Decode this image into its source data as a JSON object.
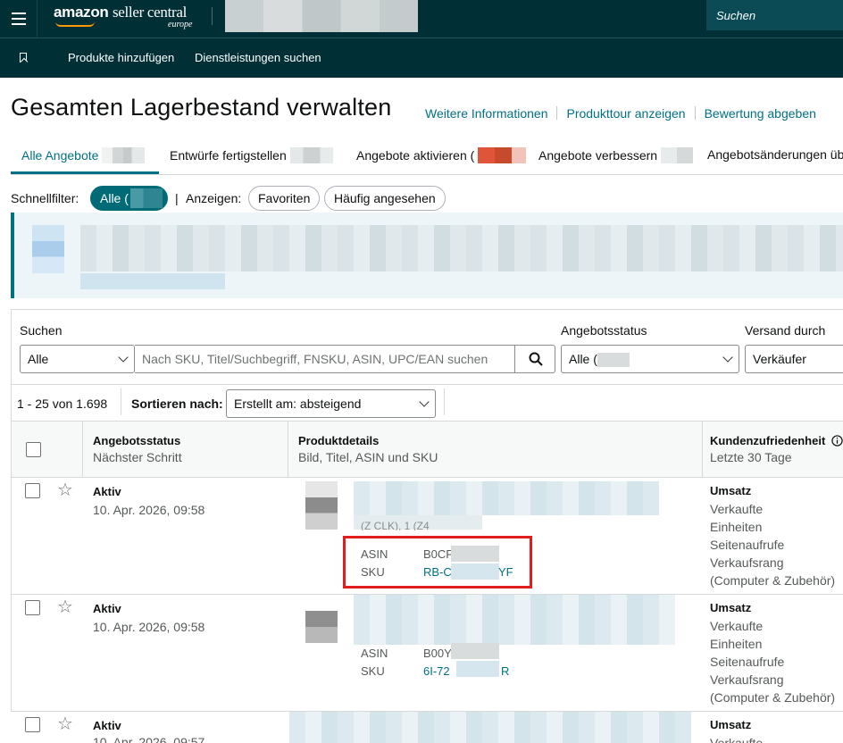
{
  "topbar": {
    "logo_main": "amazon",
    "logo_seller": "seller central",
    "logo_region": "europe",
    "search_placeholder": "Suchen"
  },
  "subnav": {
    "items": [
      "Produkte hinzufügen",
      "Dienstleistungen suchen"
    ]
  },
  "page": {
    "title": "Gesamten Lagerbestand verwalten",
    "links": [
      "Weitere Informationen",
      "Produkttour anzeigen",
      "Bewertung abgeben"
    ]
  },
  "tabs": [
    {
      "label": "Alle Angebote"
    },
    {
      "label": "Entwürfe fertigstellen"
    },
    {
      "label": "Angebote aktivieren ("
    },
    {
      "label": "Angebote verbessern"
    },
    {
      "label": "Angebotsänderungen üb"
    }
  ],
  "quickfilter": {
    "label": "Schnellfilter:",
    "all": "Alle (",
    "divider": "|",
    "show_label": "Anzeigen:",
    "favorites": "Favoriten",
    "frequent": "Häufig angesehen"
  },
  "filters": {
    "search_label": "Suchen",
    "search_scope": "Alle",
    "search_placeholder": "Nach SKU, Titel/Suchbegriff, FNSKU, ASIN, UPC/EAN suchen",
    "status_label": "Angebotsstatus",
    "status_value": "Alle (",
    "fulfillment_label": "Versand durch",
    "fulfillment_value": "Verkäufer"
  },
  "pager": {
    "range": "1 - 25 von 1.698",
    "sort_label": "Sortieren nach:",
    "sort_value": "Erstellt am: absteigend"
  },
  "table": {
    "headers": [
      {
        "title": "Angebotsstatus",
        "sub": "Nächster Schritt"
      },
      {
        "title": "Produktdetails",
        "sub": "Bild, Titel, ASIN und SKU"
      },
      {
        "title": "Kundenzufriedenheit",
        "sub": "Letzte 30 Tage"
      }
    ],
    "rows": [
      {
        "status": "Aktiv",
        "date": "10. Apr. 2026, 09:58",
        "title_fragment": "(Z CLK), 1 (Z4",
        "asin_label": "ASIN",
        "asin": "B0CF",
        "sku_label": "SKU",
        "sku_start": "RB-C",
        "sku_end": "YF",
        "metrics": [
          "Umsatz",
          "Verkaufte",
          "Einheiten",
          "Seitenaufrufe",
          "Verkaufsrang",
          "(Computer & Zubehör)"
        ]
      },
      {
        "status": "Aktiv",
        "date": "10. Apr. 2026, 09:58",
        "asin_label": "ASIN",
        "asin": "B00Y",
        "sku_label": "SKU",
        "sku_start": "6I-72",
        "sku_end": "R",
        "metrics": [
          "Umsatz",
          "Verkaufte",
          "Einheiten",
          "Seitenaufrufe",
          "Verkaufsrang",
          "(Computer & Zubehör)"
        ]
      },
      {
        "status": "Aktiv",
        "date": "10. Apr. 2026, 09:57",
        "metrics": [
          "Umsatz",
          "Verkaufte"
        ]
      }
    ]
  },
  "colors": {
    "header_bg": "#002f36",
    "link": "#007185",
    "highlight_border": "#e01e1e"
  }
}
